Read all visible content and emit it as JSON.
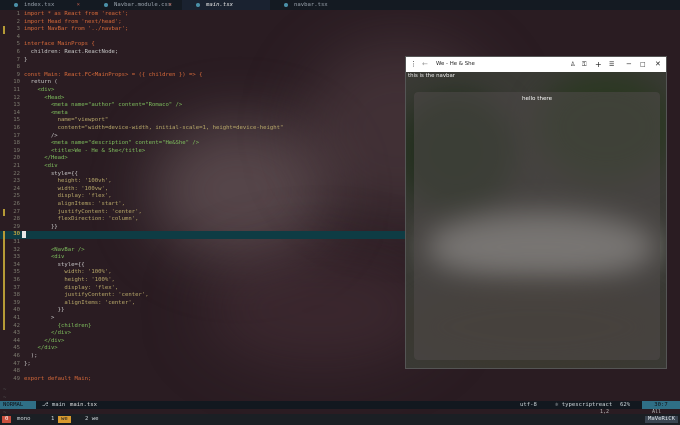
{
  "tabs": [
    {
      "label": "index.tsx",
      "active": false
    },
    {
      "label": "Navbar.module.css",
      "active": false
    },
    {
      "label": "main.tsx",
      "active": true
    },
    {
      "label": "navbar.tsx",
      "active": false
    }
  ],
  "editor": {
    "current_line": 30,
    "lines": [
      "import * as React from 'react';",
      "import Head from 'next/head';",
      "import NavBar from '../navbar';",
      "",
      "interface MainProps {",
      "  children: React.ReactNode;",
      "}",
      "",
      "const Main: React.FC<MainProps> = ({ children }) => {",
      "  return (",
      "    <div>",
      "      <Head>",
      "        <meta name=\"author\" content=\"Romaco\" />",
      "        <meta",
      "          name=\"viewport\"",
      "          content=\"width=device-width, initial-scale=1, height=device-height\"",
      "        />",
      "        <meta name=\"description\" content=\"He&She\" />",
      "        <title>We - He & She</title>",
      "      </Head>",
      "      <div",
      "        style={{",
      "          height: '100vh',",
      "          width: '100vw',",
      "          display: 'flex',",
      "          alignItems: 'start',",
      "          justifyContent: 'center',",
      "          flexDirection: 'column',",
      "        }}",
      "",
      "",
      "        <NavBar />",
      "        <div",
      "          style={{",
      "            width: '100%',",
      "            height: '100%',",
      "            display: 'flex',",
      "            justifyContent: 'center',",
      "            alignItems: 'center',",
      "          }}",
      "        >",
      "          {children}",
      "        </div>",
      "      </div>",
      "    </div>",
      "  );",
      "};",
      "",
      "export default Main;"
    ]
  },
  "statusline": {
    "mode": "NORMAL",
    "branch": "main",
    "file": "main.tsx",
    "encoding": "utf-8",
    "filetype": "typescriptreact",
    "percent": "62%",
    "position": "30:7"
  },
  "cmdline": {
    "position": "1,2",
    "scroll": "All"
  },
  "tmux": {
    "session": "0",
    "windows": [
      {
        "index": "0",
        "name": "mono"
      },
      {
        "index": "1",
        "name": "we"
      },
      {
        "index": "2",
        "name": "we"
      }
    ],
    "host": "MaVeRiCK"
  },
  "browser": {
    "title": "We - He & She",
    "navbar_text": "this is the navbar",
    "hello_text": "hello there"
  },
  "colors": {
    "accent": "#2f6f86",
    "keyword": "#d86a3a",
    "string": "#b9a96a",
    "tmux_session": "#c94f3d",
    "tmux_active_window": "#d89a2f"
  }
}
